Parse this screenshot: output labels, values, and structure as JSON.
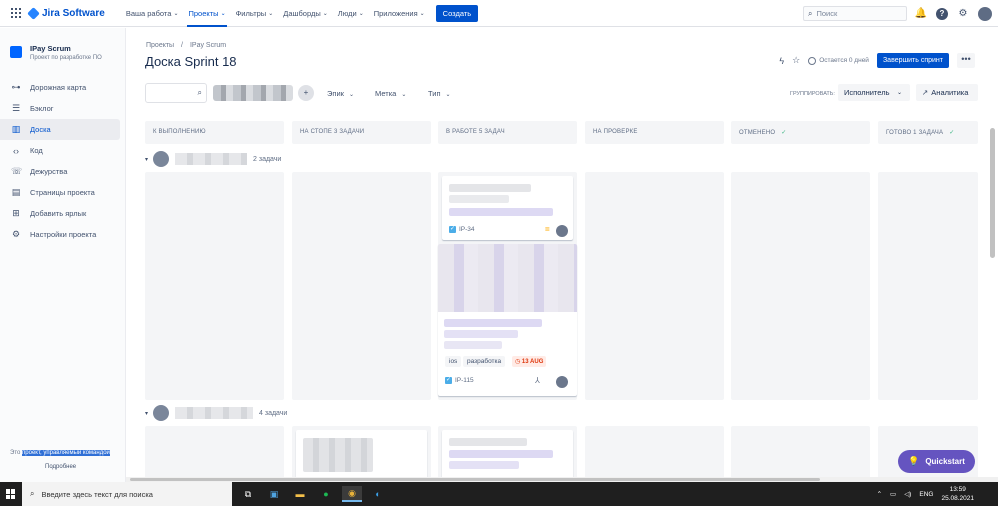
{
  "topbar": {
    "logo": "Jira Software",
    "nav": [
      {
        "label": "Ваша работа",
        "active": false
      },
      {
        "label": "Проекты",
        "active": true
      },
      {
        "label": "Фильтры",
        "active": false
      },
      {
        "label": "Дашборды",
        "active": false
      },
      {
        "label": "Люди",
        "active": false
      },
      {
        "label": "Приложения",
        "active": false
      }
    ],
    "create_label": "Создать",
    "search_placeholder": "Поиск"
  },
  "sidebar": {
    "project_name": "IPay Scrum",
    "project_sub": "Проект по разработке ПО",
    "items": [
      {
        "label": "Дорожная карта",
        "icon": "roadmap-icon"
      },
      {
        "label": "Бэклог",
        "icon": "backlog-icon"
      },
      {
        "label": "Доска",
        "icon": "board-icon",
        "active": true
      },
      {
        "label": "Код",
        "icon": "code-icon"
      },
      {
        "label": "Дежурства",
        "icon": "on-call-icon"
      },
      {
        "label": "Страницы проекта",
        "icon": "pages-icon"
      },
      {
        "label": "Добавить ярлык",
        "icon": "add-shortcut-icon"
      },
      {
        "label": "Настройки проекта",
        "icon": "settings-icon"
      }
    ],
    "footer_prefix": "Это",
    "footer_highlight": "проект, управляемый командой",
    "footer_more": "Подробнее"
  },
  "header": {
    "breadcrumb": [
      "Проекты",
      "/",
      "IPay Scrum"
    ],
    "title": "Доска Sprint 18",
    "remaining": "Остается 0 дней",
    "finish_sprint": "Завершить спринт",
    "more": "•••"
  },
  "filters": {
    "epic": "Эпик",
    "label": "Метка",
    "type": "Тип",
    "group_by_label": "ГРУППИРОВАТЬ:",
    "group_by_value": "Исполнитель",
    "insights": "Аналитика"
  },
  "columns": [
    {
      "title": "К ВЫПОЛНЕНИЮ",
      "done": false
    },
    {
      "title": "НА СТОПЕ 3 ЗАДАЧИ",
      "done": false
    },
    {
      "title": "В РАБОТЕ 5 ЗАДАЧ",
      "done": false
    },
    {
      "title": "НА ПРОВЕРКЕ",
      "done": false
    },
    {
      "title": "ОТМЕНЕНО",
      "done": true
    },
    {
      "title": "ГОТОВО 1 ЗАДАЧА",
      "done": true
    }
  ],
  "swimlanes": [
    {
      "count": "2 задачи"
    },
    {
      "count": "4 задачи"
    }
  ],
  "cards": {
    "card1_key": "IP-34",
    "card2_key": "IP-115",
    "card2_labels": [
      "ios",
      "разработка"
    ],
    "card2_due": "13 AUG"
  },
  "quickstart": "Quickstart",
  "taskbar": {
    "search_placeholder": "Введите здесь текст для поиска",
    "lang": "ENG",
    "time": "13:59",
    "date": "25.08.2021"
  },
  "colors": {
    "brand_blue": "#0052cc",
    "quickstart_purple": "#6554c0",
    "due_red": "#de350b",
    "done_green": "#36b37e"
  }
}
